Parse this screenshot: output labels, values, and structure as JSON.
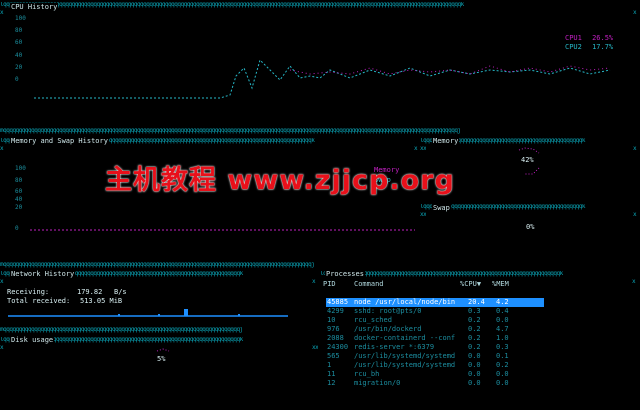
{
  "cpu": {
    "title": "CPU History",
    "ticks": [
      "100",
      "80",
      "60",
      "40",
      "20",
      "0"
    ],
    "legend": [
      {
        "label": "CPU1",
        "value": "26.5%",
        "color": "#c020c0"
      },
      {
        "label": "CPU2",
        "value": "17.7%",
        "color": "#26b8c8"
      }
    ]
  },
  "memory_history": {
    "title": "Memory and Swap History",
    "ticks": [
      "100",
      "80",
      "60",
      "40",
      "20",
      "0"
    ],
    "legend": [
      {
        "label": "Memory",
        "color": "#c020c0"
      },
      {
        "label": "Swap",
        "color": "#26b8c8"
      }
    ]
  },
  "memory": {
    "title": "Memory",
    "value": "42%"
  },
  "swap": {
    "title": "Swap",
    "value": "0%"
  },
  "network": {
    "title": "Network History",
    "receiving_label": "Receiving:",
    "receiving_value": "179.82",
    "receiving_unit": "B/s",
    "total_label": "Total received:",
    "total_value": "513.05 MiB"
  },
  "disk": {
    "title": "Disk usage",
    "value": "5%"
  },
  "processes": {
    "title": "Processes",
    "columns": [
      "PID",
      "Command",
      "%CPU▼",
      "%MEM"
    ],
    "rows": [
      {
        "pid": "45885",
        "cmd": "node /usr/local/node/bin",
        "cpu": "20.4",
        "mem": "4.2",
        "selected": true
      },
      {
        "pid": "4299",
        "cmd": "sshd: root@pts/0",
        "cpu": "0.3",
        "mem": "0.4"
      },
      {
        "pid": "10",
        "cmd": "rcu_sched",
        "cpu": "0.2",
        "mem": "0.0"
      },
      {
        "pid": "976",
        "cmd": "/usr/bin/dockerd",
        "cpu": "0.2",
        "mem": "4.7"
      },
      {
        "pid": "2088",
        "cmd": "docker-containerd --conf",
        "cpu": "0.2",
        "mem": "1.0"
      },
      {
        "pid": "24300",
        "cmd": "redis-server *:6379",
        "cpu": "0.2",
        "mem": "0.3"
      },
      {
        "pid": "565",
        "cmd": "/usr/lib/systemd/systemd",
        "cpu": "0.0",
        "mem": "0.1"
      },
      {
        "pid": "1",
        "cmd": "/usr/lib/systemd/systemd",
        "cpu": "0.0",
        "mem": "0.2"
      },
      {
        "pid": "11",
        "cmd": "rcu_bh",
        "cpu": "0.0",
        "mem": "0.0"
      },
      {
        "pid": "12",
        "cmd": "migration/0",
        "cpu": "0.0",
        "mem": "0.0"
      }
    ]
  },
  "watermark": "主机教程 www.zjjcp.org",
  "colors": {
    "border": "#0aa6b8",
    "magenta": "#c020c0",
    "cyan": "#26b8c8",
    "highlight": "#1e90ff",
    "watermark": "#e8101a"
  }
}
